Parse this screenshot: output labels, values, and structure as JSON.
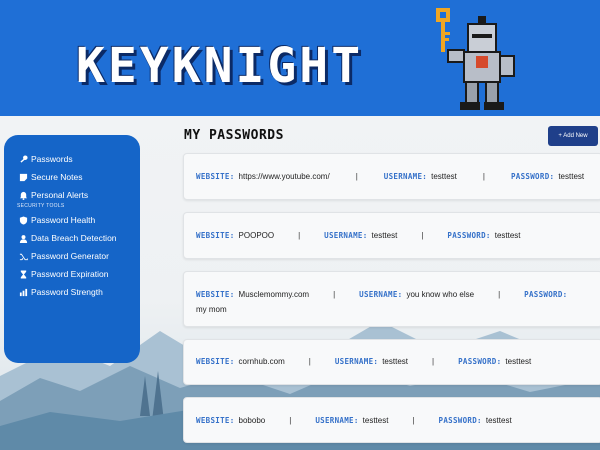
{
  "app": {
    "logo_text": "KEYKNIGHT"
  },
  "sidebar": {
    "items_top": [
      {
        "label": "Passwords",
        "icon": "key-icon"
      },
      {
        "label": "Secure Notes",
        "icon": "note-icon"
      },
      {
        "label": "Personal Alerts",
        "icon": "bell-icon"
      }
    ],
    "section_label": "SECURITY TOOLS",
    "items_tools": [
      {
        "label": "Password Health",
        "icon": "shield-icon"
      },
      {
        "label": "Data Breach Detection",
        "icon": "user-secret-icon"
      },
      {
        "label": "Password Generator",
        "icon": "shuffle-icon"
      },
      {
        "label": "Password Expiration",
        "icon": "hourglass-icon"
      },
      {
        "label": "Password Strength",
        "icon": "bar-chart-icon"
      }
    ]
  },
  "main": {
    "title": "MY PASSWORDS",
    "add_button": "+ Add New",
    "labels": {
      "website": "WEBSITE:",
      "username": "USERNAME:",
      "password": "PASSWORD:"
    },
    "separator": "|",
    "entries": [
      {
        "website": "https://www.youtube.com/",
        "username": "testtest",
        "password": "testtest"
      },
      {
        "website": "POOPOO",
        "username": "testtest",
        "password": "testtest"
      },
      {
        "website": "Musclemommy.com",
        "username": "you know who else",
        "password": "my mom"
      },
      {
        "website": "cornhub.com",
        "username": "testtest",
        "password": "testtest"
      },
      {
        "website": "bobobo",
        "username": "testtest",
        "password": "testtest"
      }
    ]
  },
  "colors": {
    "header_blue": "#1f6fd6",
    "sidebar_blue": "#1565c8",
    "label_blue": "#3571c9",
    "button_navy": "#1f3f8a"
  }
}
